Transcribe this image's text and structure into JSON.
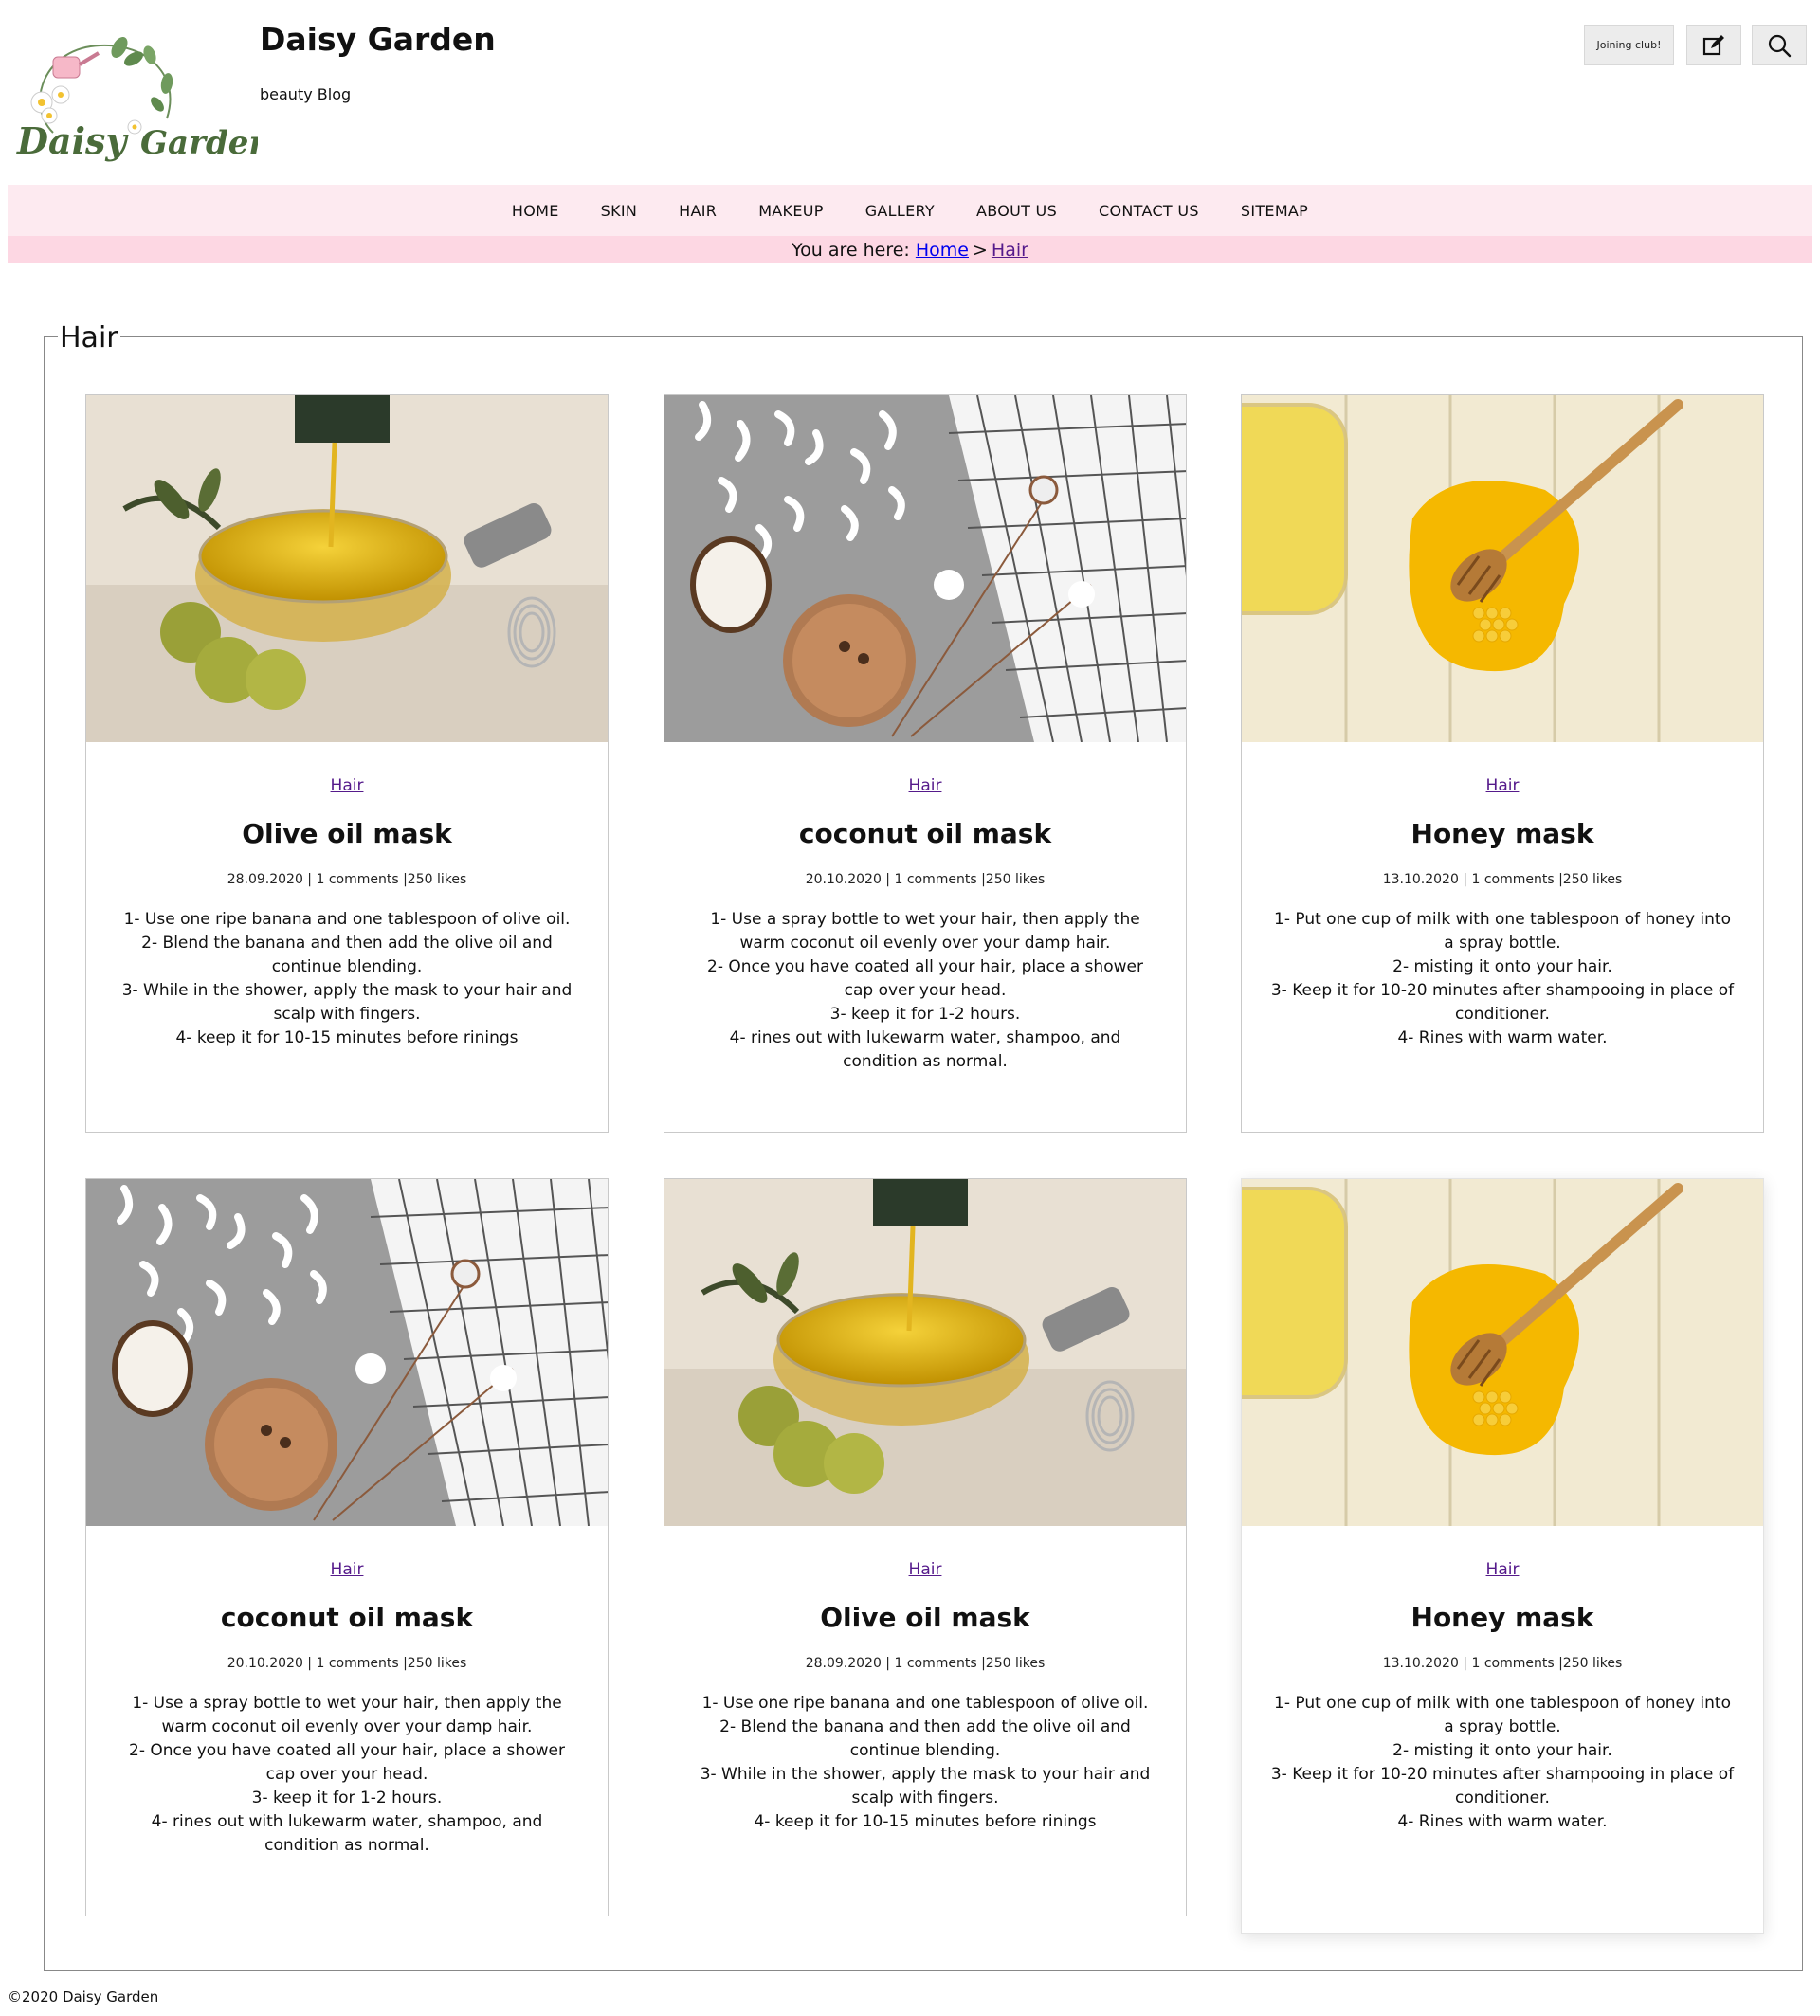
{
  "site": {
    "title": "Daisy Garden",
    "tagline": "beauty Blog",
    "logo_text": "Daisy Garden"
  },
  "header_buttons": {
    "join_label": "Joining club!",
    "edit_icon": "edit-icon",
    "search_icon": "search-icon"
  },
  "nav": {
    "items": [
      "HOME",
      "SKIN",
      "HAIR",
      "MAKEUP",
      "GALLERY",
      "ABOUT US",
      "CONTACT US",
      "SITEMAP"
    ]
  },
  "breadcrumb": {
    "prefix": "You are here:",
    "home": "Home",
    "separator": ">",
    "current": "Hair"
  },
  "section": {
    "legend": "Hair"
  },
  "colors": {
    "nav_bg": "#fdeaf0",
    "crumb_bg": "#fdd7e3",
    "link": "#0000ee",
    "visited": "#551a8b"
  },
  "cards": [
    {
      "image": "olive-oil-photo",
      "category": "Hair",
      "title": "Olive oil mask",
      "meta": "28.09.2020 | 1 comments |250 likes",
      "steps": [
        "1- Use one ripe banana and one tablespoon of olive oil.",
        "2- Blend the banana and then add the olive oil and continue blending.",
        "3- While in the shower, apply the mask to your hair and scalp with fingers.",
        "4- keep it for 10-15 minutes before rinings"
      ]
    },
    {
      "image": "coconut-oil-photo",
      "category": "Hair",
      "title": "coconut oil mask",
      "meta": "20.10.2020 | 1 comments |250 likes",
      "steps": [
        "1- Use a spray bottle to wet your hair, then apply the warm coconut oil evenly over your damp hair.",
        "2- Once you have coated all your hair, place a shower cap over your head.",
        "3- keep it for 1-2 hours.",
        "4- rines out with lukewarm water, shampoo, and condition as normal."
      ]
    },
    {
      "image": "honey-photo",
      "category": "Hair",
      "title": "Honey mask",
      "meta": "13.10.2020 | 1 comments |250 likes",
      "steps": [
        "1- Put one cup of milk with one tablespoon of honey into a spray bottle.",
        "2- misting it onto your hair.",
        "3- Keep it for 10-20 minutes after shampooing in place of conditioner.",
        "4- Rines with warm water."
      ]
    },
    {
      "image": "coconut-oil-photo",
      "category": "Hair",
      "title": "coconut oil mask",
      "meta": "20.10.2020 | 1 comments |250 likes",
      "steps": [
        "1- Use a spray bottle to wet your hair, then apply the warm coconut oil evenly over your damp hair.",
        "2- Once you have coated all your hair, place a shower cap over your head.",
        "3- keep it for 1-2 hours.",
        "4- rines out with lukewarm water, shampoo, and condition as normal."
      ]
    },
    {
      "image": "olive-oil-photo",
      "category": "Hair",
      "title": "Olive oil mask",
      "meta": "28.09.2020 | 1 comments |250 likes",
      "steps": [
        "1- Use one ripe banana and one tablespoon of olive oil.",
        "2- Blend the banana and then add the olive oil and continue blending.",
        "3- While in the shower, apply the mask to your hair and scalp with fingers.",
        "4- keep it for 10-15 minutes before rinings"
      ]
    },
    {
      "image": "honey-photo",
      "category": "Hair",
      "title": "Honey mask",
      "meta": "13.10.2020 | 1 comments |250 likes",
      "steps": [
        "1- Put one cup of milk with one tablespoon of honey into a spray bottle.",
        "2- misting it onto your hair.",
        "3- Keep it for 10-20 minutes after shampooing in place of conditioner.",
        "4- Rines with warm water."
      ]
    }
  ],
  "footer": {
    "copyright": "©2020 Daisy Garden"
  }
}
